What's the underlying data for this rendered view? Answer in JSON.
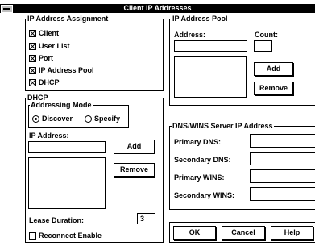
{
  "window": {
    "title": "Client IP Addresses"
  },
  "ip_assignment": {
    "title": "IP Address Assignment",
    "items": [
      {
        "label": "Client",
        "checked": true
      },
      {
        "label": "User List",
        "checked": true
      },
      {
        "label": "Port",
        "checked": true
      },
      {
        "label": "IP Address Pool",
        "checked": true
      },
      {
        "label": "DHCP",
        "checked": true
      }
    ]
  },
  "ip_pool": {
    "title": "IP Address Pool",
    "address_label": "Address:",
    "address_value": "",
    "count_label": "Count:",
    "count_value": "",
    "add_label": "Add",
    "remove_label": "Remove"
  },
  "dhcp": {
    "title": "DHCP",
    "mode_title": "Addressing Mode",
    "discover_label": "Discover",
    "specify_label": "Specify",
    "selected_mode": "Discover",
    "ip_address_label": "IP Address:",
    "ip_address_value": "",
    "add_label": "Add",
    "remove_label": "Remove",
    "lease_label": "Lease Duration:",
    "lease_value": "3",
    "reconnect_label": "Reconnect Enable",
    "reconnect_checked": false
  },
  "dns_wins": {
    "title": "DNS/WINS Server IP Address",
    "primary_dns_label": "Primary DNS:",
    "secondary_dns_label": "Secondary DNS:",
    "primary_wins_label": "Primary WINS:",
    "secondary_wins_label": "Secondary WINS:",
    "primary_dns_value": "",
    "secondary_dns_value": "",
    "primary_wins_value": "",
    "secondary_wins_value": ""
  },
  "footer": {
    "ok_label": "OK",
    "cancel_label": "Cancel",
    "help_label": "Help"
  }
}
